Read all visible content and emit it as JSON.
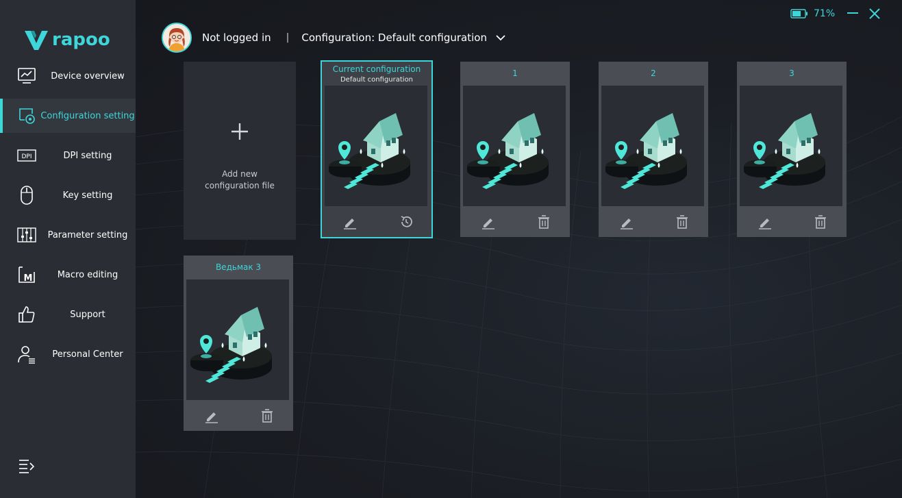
{
  "app": {
    "brand": "rapoo",
    "accent_color": "#3fd6d9"
  },
  "sidebar": {
    "items": [
      {
        "label": "Device overview",
        "icon": "monitor-chart-icon",
        "active": false
      },
      {
        "label": "Configuration setting",
        "icon": "config-gear-icon",
        "active": true
      },
      {
        "label": "DPI setting",
        "icon": "dpi-icon",
        "active": false
      },
      {
        "label": "Key setting",
        "icon": "mouse-icon",
        "active": false
      },
      {
        "label": "Parameter setting",
        "icon": "sliders-icon",
        "active": false
      },
      {
        "label": "Macro editing",
        "icon": "macro-m-icon",
        "active": false
      },
      {
        "label": "Support",
        "icon": "thumbs-up-icon",
        "active": false
      },
      {
        "label": "Personal Center",
        "icon": "user-list-icon",
        "active": false
      }
    ],
    "collapse_icon": "menu-collapse-icon"
  },
  "window": {
    "battery_percent": "71%",
    "battery_level": 0.71
  },
  "header": {
    "login_status": "Not logged in",
    "divider": "|",
    "configuration_label": "Configuration: Default configuration"
  },
  "add_card": {
    "label_line1": "Add new",
    "label_line2": "configuration file"
  },
  "cards": [
    {
      "title": "Current configuration",
      "subtitle": "Default configuration",
      "current": true,
      "actions": [
        "edit-icon",
        "reset-icon"
      ]
    },
    {
      "title": "1",
      "current": false,
      "actions": [
        "edit-icon",
        "trash-icon"
      ]
    },
    {
      "title": "2",
      "current": false,
      "actions": [
        "edit-icon",
        "trash-icon"
      ]
    },
    {
      "title": "3",
      "current": false,
      "actions": [
        "edit-icon",
        "trash-icon"
      ]
    },
    {
      "title": "Ведьмак 3",
      "current": false,
      "actions": [
        "edit-icon",
        "trash-icon"
      ]
    }
  ]
}
